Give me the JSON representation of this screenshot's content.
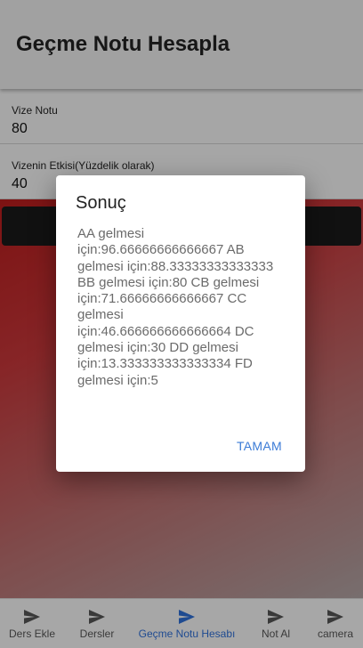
{
  "header": {
    "title": "Geçme Notu Hesapla"
  },
  "form": {
    "fields": [
      {
        "label": "Vize Notu",
        "value": "80"
      },
      {
        "label": "Vizenin Etkisi(Yüzdelik olarak)",
        "value": "40"
      }
    ]
  },
  "dialog": {
    "title": "Sonuç",
    "body": "AA gelmesi için:96.66666666666667 AB gelmesi için:88.33333333333333 BB gelmesi için:80 CB gelmesi için:71.66666666666667 CC gelmesi için:46.666666666666664 DC gelmesi için:30 DD gelmesi için:13.333333333333334 FD gelmesi için:5",
    "ok_label": "TAMAM"
  },
  "bottom_nav": {
    "items": [
      {
        "label": "Ders Ekle",
        "icon": "send-icon"
      },
      {
        "label": "Dersler",
        "icon": "send-icon"
      },
      {
        "label": "Geçme Notu Hesabı",
        "icon": "send-icon",
        "active": true
      },
      {
        "label": "Not Al",
        "icon": "send-icon"
      },
      {
        "label": "camera",
        "icon": "send-icon"
      }
    ]
  },
  "colors": {
    "accent": "#2f6fd6",
    "dialog_button": "#3b7bd6",
    "gradient_start": "#b91c1c",
    "gradient_end": "#b0a3a3"
  }
}
